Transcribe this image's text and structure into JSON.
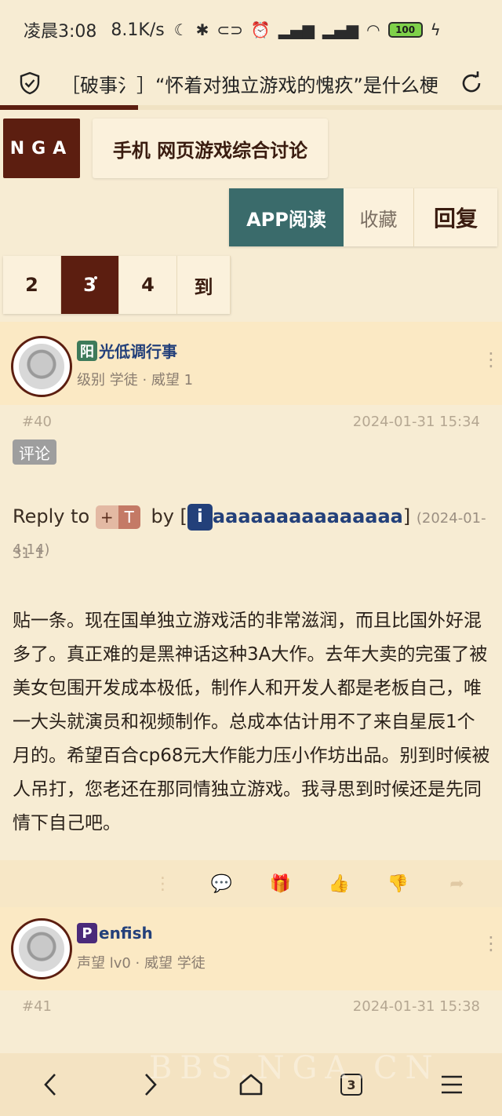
{
  "status_bar": {
    "time": "凌晨3:08",
    "speed": "8.1K/s",
    "battery": "100"
  },
  "browser": {
    "page_title": "［破事氵］“怀着对独立游戏的愧疚”是什么梗",
    "tab_count": "3",
    "watermark": "BBS.NGA.CN"
  },
  "header": {
    "logo": "NGA",
    "board_name": "手机 网页游戏综合讨论"
  },
  "actions": {
    "app_read": "APP阅读",
    "favorite": "收藏",
    "reply": "回复"
  },
  "pager": {
    "pages": [
      "2",
      "3",
      "4"
    ],
    "goto": "到"
  },
  "posts": [
    {
      "badge": "阳",
      "username_rest": "光低调行事",
      "meta": "级别 学徒 · 威望 1",
      "floor": "#40",
      "time": "2024-01-31 15:34",
      "tag": "评论",
      "reply_prefix": "Reply to",
      "chip_plus": "+",
      "chip_t": "T",
      "by": "by",
      "bracket_open": "[",
      "reply_badge": "i",
      "reply_user": "aaaaaaaaaaaaaaa",
      "bracket_close": "]",
      "reply_time_a": "(2024-01-31 1",
      "reply_time_b": "4:14)",
      "content": "贴一条。现在国单独立游戏活的非常滋润，而且比国外好混多了。真正难的是黑神话这种3A大作。去年大卖的完蛋了被美女包围开发成本极低，制作人和开发人都是老板自己，唯一大头就演员和视频制作。总成本估计用不了来自星辰1个月的。希望百合cp68元大作能力压小作坊出品。别到时候被人吊打，您老还在那同情独立游戏。我寻思到时候还是先同情下自己吧。"
    },
    {
      "badge": "P",
      "username_rest": "enfish",
      "meta": "声望 lv0 · 威望 学徒",
      "floor": "#41",
      "time": "2024-01-31 15:38"
    }
  ],
  "colors": {
    "brand": "#5c1e10",
    "app_button": "#3a6b6b",
    "badge_green": "#3e7a5a",
    "badge_purple": "#4a2a7a",
    "username": "#23407a"
  }
}
